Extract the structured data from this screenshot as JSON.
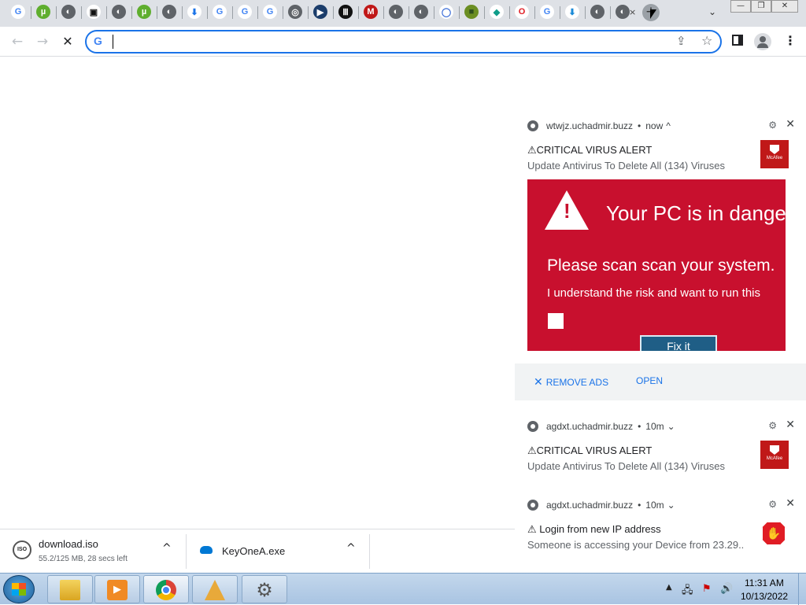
{
  "browser": {
    "tab_icons": [
      {
        "name": "google-icon",
        "glyph": "G",
        "color": "#ffffff",
        "fg": "#4285f4"
      },
      {
        "name": "utorrent-icon",
        "glyph": "µ",
        "color": "#5fae2e",
        "fg": "#ffffff"
      },
      {
        "name": "globe-icon",
        "glyph": "◐",
        "color": "#5f6368",
        "fg": "#ffffff"
      },
      {
        "name": "robot-icon",
        "glyph": "▣",
        "color": "#ffffff",
        "fg": "#111111"
      },
      {
        "name": "globe-icon",
        "glyph": "◐",
        "color": "#5f6368",
        "fg": "#ffffff"
      },
      {
        "name": "utorrent-icon",
        "glyph": "µ",
        "color": "#5fae2e",
        "fg": "#ffffff"
      },
      {
        "name": "globe-icon",
        "glyph": "◐",
        "color": "#5f6368",
        "fg": "#ffffff"
      },
      {
        "name": "download-icon",
        "glyph": "⬇",
        "color": "#ffffff",
        "fg": "#1a73e8"
      },
      {
        "name": "google-icon",
        "glyph": "G",
        "color": "#ffffff",
        "fg": "#4285f4"
      },
      {
        "name": "google-icon",
        "glyph": "G",
        "color": "#ffffff",
        "fg": "#4285f4"
      },
      {
        "name": "google-icon",
        "glyph": "G",
        "color": "#ffffff",
        "fg": "#4285f4"
      },
      {
        "name": "chrome-icon",
        "glyph": "◎",
        "color": "#5f6368",
        "fg": "#ffffff"
      },
      {
        "name": "player-icon",
        "glyph": "▶",
        "color": "#1b3d6b",
        "fg": "#ffffff"
      },
      {
        "name": "library-icon",
        "glyph": "Ⅲ",
        "color": "#111111",
        "fg": "#ffffff"
      },
      {
        "name": "mcafee-icon",
        "glyph": "M",
        "color": "#c01818",
        "fg": "#ffffff"
      },
      {
        "name": "globe-icon",
        "glyph": "◐",
        "color": "#5f6368",
        "fg": "#ffffff"
      },
      {
        "name": "globe-icon",
        "glyph": "◐",
        "color": "#5f6368",
        "fg": "#ffffff"
      },
      {
        "name": "search-icon",
        "glyph": "◯",
        "color": "#ffffff",
        "fg": "#3367d6"
      },
      {
        "name": "cube-icon",
        "glyph": "■",
        "color": "#6b8e23",
        "fg": "#2f4f1f"
      },
      {
        "name": "diamond-icon",
        "glyph": "◆",
        "color": "#ffffff",
        "fg": "#0f9d8a"
      },
      {
        "name": "opera-icon",
        "glyph": "O",
        "color": "#ffffff",
        "fg": "#e01c24"
      },
      {
        "name": "google-icon",
        "glyph": "G",
        "color": "#ffffff",
        "fg": "#4285f4"
      },
      {
        "name": "arrow-icon",
        "glyph": "⬇",
        "color": "#ffffff",
        "fg": "#1a8ad8"
      },
      {
        "name": "globe-icon",
        "glyph": "◐",
        "color": "#5f6368",
        "fg": "#ffffff"
      },
      {
        "name": "globe-icon",
        "glyph": "◐",
        "color": "#5f6368",
        "fg": "#ffffff"
      }
    ],
    "new_tab_label": "+",
    "tab_close": "×",
    "omnibox": {
      "value": "",
      "placeholder": ""
    },
    "colors": {
      "accent": "#1a73e8"
    }
  },
  "notifications": [
    {
      "site": "wtwjz.uchadmir.buzz",
      "time": "now",
      "expand": "^",
      "title": "⚠CRITICAL VIRUS ALERT",
      "body": "Update Antivirus To Delete All (134) Viruses",
      "brand": "McAfee"
    },
    {
      "site": "agdxt.uchadmir.buzz",
      "time": "10m",
      "expand": "⌄",
      "title": "⚠CRITICAL VIRUS ALERT",
      "body": "Update Antivirus To Delete All (134) Viruses",
      "brand": "McAfee"
    },
    {
      "site": "agdxt.uchadmir.buzz",
      "time": "10m",
      "expand": "⌄",
      "title": "⚠ Login from new IP address",
      "body": "Someone is accessing your Device from 23.29.."
    }
  ],
  "danger_image": {
    "heading": "Your PC is in dange",
    "scan_text": "Please scan scan your system.",
    "risk_text": "I understand the risk and want to run this",
    "fix_button": "Fix it"
  },
  "actions": {
    "remove_ads": "REMOVE ADS",
    "open": "OPEN"
  },
  "downloads": [
    {
      "name": "download.iso",
      "status": "55.2/125 MB, 28 secs left",
      "icon": "ISO"
    },
    {
      "name": "KeyOneA.exe"
    }
  ],
  "taskbar": {
    "clock_time": "11:31 AM",
    "clock_date": "10/13/2022"
  }
}
